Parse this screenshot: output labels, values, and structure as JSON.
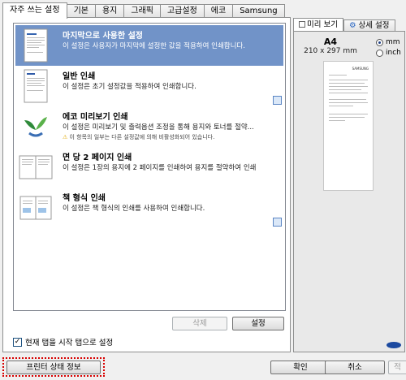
{
  "tabs": [
    "자주 쓰는 설정",
    "기본",
    "용지",
    "그래픽",
    "고급설정",
    "에코",
    "Samsung"
  ],
  "favorites": [
    {
      "title": "마지막으로 사용한 설정",
      "desc": "이 설정은 사용자가 마지막에 설정한 값을 적용하여 인쇄합니다.",
      "selected": true,
      "icon": "page-thumbnail-icon"
    },
    {
      "title": "일반 인쇄",
      "desc": "이 설정은 초기 설정값을 적용하여 인쇄합니다.",
      "icon": "page-thumbnail-icon"
    },
    {
      "title": "에코 미리보기 인쇄",
      "desc": "이 설정은 미리보기 및 출력옵션 조정을 통해 용지와 토너를 절약...",
      "warning": "이 항목의 일부는 다른 설정값에 의해 비활성화되어 있습니다.",
      "icon": "eco-leaf-icon"
    },
    {
      "title": "면 당 2 페이지 인쇄",
      "desc": "이 설정은 1장의 용지에 2 페이지를 인쇄하여 용지를 절약하여 인쇄",
      "icon": "two-pages-icon"
    },
    {
      "title": "책 형식 인쇄",
      "desc": "이 설정은 책 형식의 인쇄를 사용하여 인쇄합니다.",
      "icon": "booklet-icon"
    }
  ],
  "buttons": {
    "delete": "삭제",
    "settings": "설정",
    "ok": "확인",
    "cancel": "취소",
    "apply": "적",
    "printer_status": "프린터 상태 정보"
  },
  "start_tab_checkbox": {
    "label": "현재 탭을 시작 탭으로 설정",
    "checked": true
  },
  "right_tabs": [
    "미리 보기",
    "상세 설정"
  ],
  "preview": {
    "paper_name": "A4",
    "paper_dims": "210 x 297 mm",
    "units": [
      {
        "label": "mm",
        "selected": true
      },
      {
        "label": "inch",
        "selected": false
      }
    ],
    "brand": "SAMSUNG"
  },
  "colors": {
    "selected_row": "#7193c8",
    "highlight_border": "#d80000"
  }
}
